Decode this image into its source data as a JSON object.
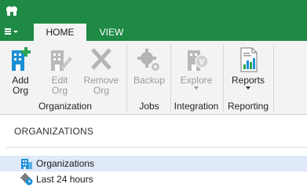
{
  "ribbon": {
    "tabs": [
      {
        "label": "HOME"
      },
      {
        "label": "VIEW"
      }
    ],
    "buttons": {
      "add_org": "Add\nOrg",
      "edit_org": "Edit\nOrg",
      "remove_org": "Remove\nOrg",
      "backup": "Backup",
      "explore": "Explore",
      "reports": "Reports"
    },
    "groups": {
      "organization": "Organization",
      "jobs": "Jobs",
      "integration": "Integration",
      "reporting": "Reporting"
    }
  },
  "panel": {
    "title": "ORGANIZATIONS",
    "items": [
      {
        "label": "Organizations",
        "icon": "building-icon",
        "selected": true
      },
      {
        "label": "Last 24 hours",
        "icon": "gear-clock-icon",
        "selected": false
      }
    ]
  },
  "colors": {
    "brand": "#1e8a45",
    "accent": "#1c8fd6",
    "selected_bg": "#dfe9f7"
  }
}
